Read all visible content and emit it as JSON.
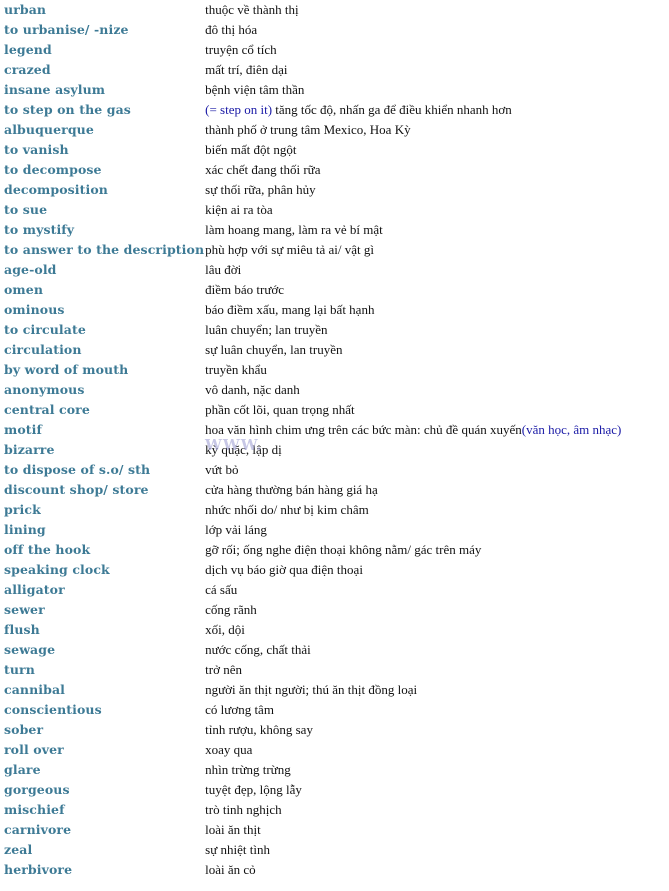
{
  "colors": {
    "term": "#3d7a95",
    "meaning": "#111111",
    "note": "#1a1aa6",
    "background": "#ffffff"
  },
  "watermark": "WWW.",
  "entries": [
    {
      "term": "urban",
      "meaning": "thuộc về thành thị"
    },
    {
      "term": "to urbanise/ -nize",
      "meaning": "đô thị hóa"
    },
    {
      "term": "legend",
      "meaning": "truyện cổ tích"
    },
    {
      "term": "crazed",
      "meaning": "mất trí, điên dại"
    },
    {
      "term": "insane asylum",
      "meaning": "bệnh viện tâm thần"
    },
    {
      "term": "to step on the gas",
      "note_before": "(= step on it)",
      "meaning": " tăng tốc độ, nhấn ga để điều khiển nhanh hơn"
    },
    {
      "term": "albuquerque",
      "meaning": "thành phố ở trung tâm Mexico, Hoa Kỳ"
    },
    {
      "term": "to vanish",
      "meaning": "biến mất đột ngột"
    },
    {
      "term": "to decompose",
      "meaning": "xác chết đang thối rữa"
    },
    {
      "term": "decomposition",
      "meaning": "sự thối rữa, phân hủy"
    },
    {
      "term": "to sue",
      "meaning": "kiện ai ra tòa"
    },
    {
      "term": "to mystify",
      "meaning": "làm hoang mang, làm ra vẻ bí mật"
    },
    {
      "term": "to answer to the description",
      "meaning": "phù hợp với sự miêu tả ai/ vật gì"
    },
    {
      "term": "age-old",
      "meaning": "lâu đời"
    },
    {
      "term": "omen",
      "meaning": "điềm báo trước"
    },
    {
      "term": "ominous",
      "meaning": "báo điềm xấu, mang lại bất hạnh"
    },
    {
      "term": "to circulate",
      "meaning": "luân chuyển; lan truyền"
    },
    {
      "term": "circulation",
      "meaning": "sự luân chuyển, lan truyền"
    },
    {
      "term": "by word of mouth",
      "meaning": "truyền khẩu"
    },
    {
      "term": "anonymous",
      "meaning": "vô danh, nặc danh"
    },
    {
      "term": "central core",
      "meaning": "phần cốt lõi, quan trọng nhất"
    },
    {
      "term": "motif",
      "meaning": "hoa văn hình chim ưng trên các bức màn: chủ đề quán xuyến",
      "note_after": "(văn học, âm nhạc)"
    },
    {
      "term": "bizarre",
      "meaning": "kỳ quặc, lập dị"
    },
    {
      "term": "to dispose of s.o/ sth",
      "meaning": "vứt bỏ"
    },
    {
      "term": "discount shop/ store",
      "meaning": "cửa hàng thường bán hàng giá hạ"
    },
    {
      "term": "prick",
      "meaning": "nhức nhối do/ như bị kim châm"
    },
    {
      "term": "lining",
      "meaning": "lớp vải láng"
    },
    {
      "term": "off the hook",
      "meaning": "gỡ rối; ống nghe điện thoại không nằm/ gác trên máy"
    },
    {
      "term": "speaking clock",
      "meaning": "dịch vụ báo giờ qua điện thoại"
    },
    {
      "term": "alligator",
      "meaning": "cá sấu"
    },
    {
      "term": "sewer",
      "meaning": "cống rãnh"
    },
    {
      "term": "flush",
      "meaning": "xối, dội"
    },
    {
      "term": "sewage",
      "meaning": "nước cống, chất thải"
    },
    {
      "term": "turn",
      "meaning": "trở nên"
    },
    {
      "term": "cannibal",
      "meaning": "người ăn thịt người; thú ăn thịt đồng loại"
    },
    {
      "term": "conscientious",
      "meaning": "có lương tâm"
    },
    {
      "term": "sober",
      "meaning": "tỉnh rượu, không say"
    },
    {
      "term": "roll over",
      "meaning": "xoay qua"
    },
    {
      "term": "glare",
      "meaning": "nhìn trừng trừng"
    },
    {
      "term": "gorgeous",
      "meaning": "tuyệt đẹp, lộng lẫy"
    },
    {
      "term": "mischief",
      "meaning": "trò tinh nghịch"
    },
    {
      "term": "carnivore",
      "meaning": "loài ăn thịt"
    },
    {
      "term": "zeal",
      "meaning": "sự nhiệt tình"
    },
    {
      "term": "herbivore",
      "meaning": "loài ăn cỏ"
    }
  ]
}
